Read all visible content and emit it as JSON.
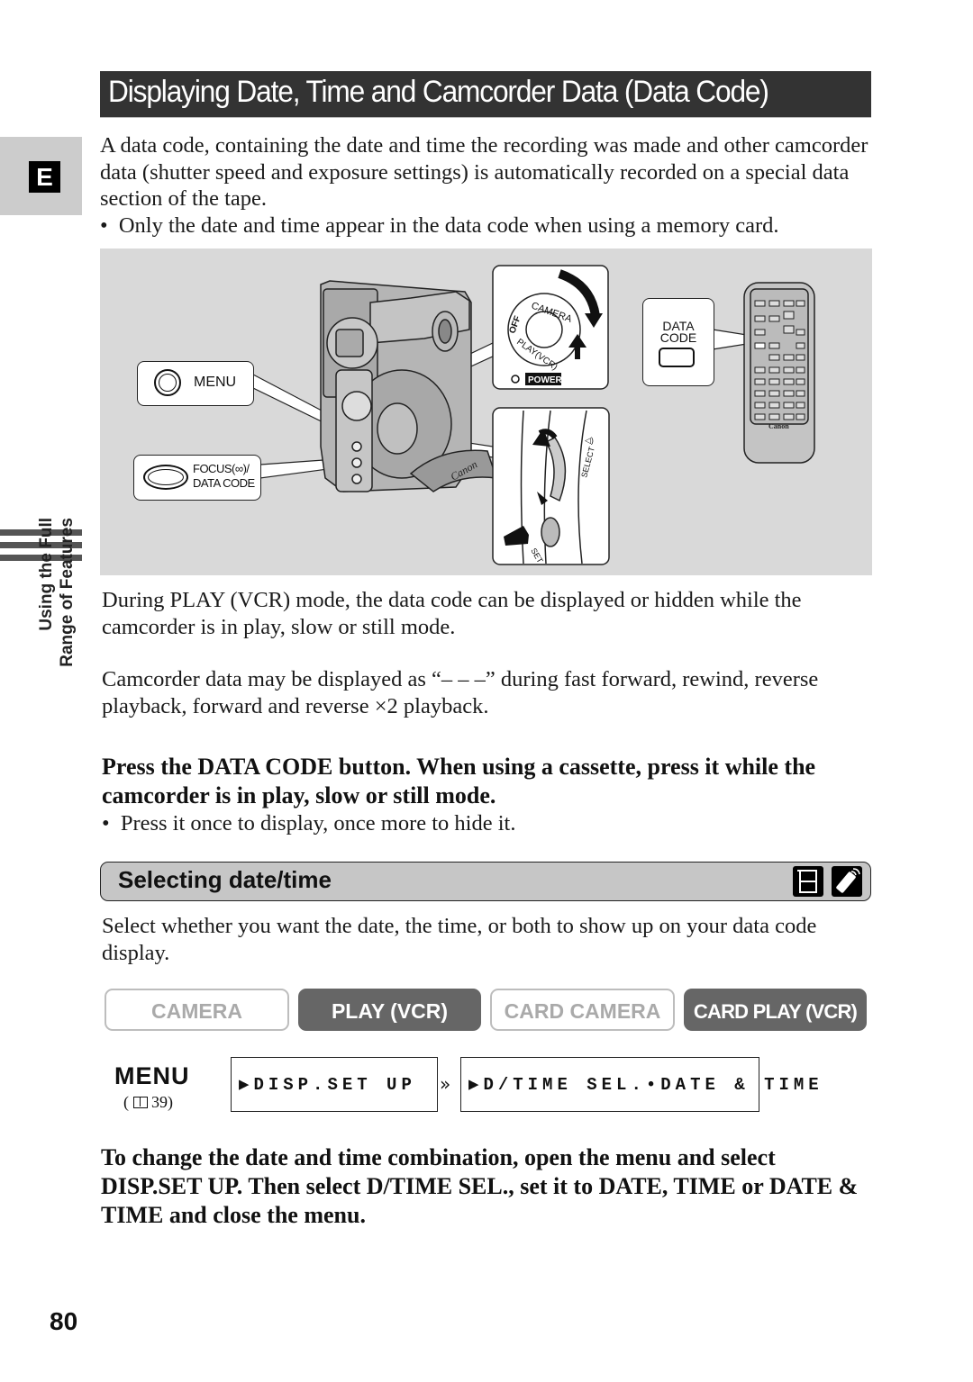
{
  "page": {
    "title": "Displaying Date, Time and Camcorder Data (Data Code)",
    "language_tab": "E",
    "side_label_line1": "Using the Full",
    "side_label_line2": "Range of Features",
    "page_number": "80"
  },
  "intro": {
    "paragraph": "A data code, containing the date and time the recording was made and other camcorder data (shutter speed and exposure settings) is automatically recorded on a special data section of the tape.",
    "bullet": "Only the date and time appear in the data code when using a memory card."
  },
  "figure": {
    "menu_callout": "MENU",
    "focus_callout_line1": "FOCUS(∞)/",
    "focus_callout_line2": "DATA CODE",
    "dial_labels": {
      "camera": "CAMERA",
      "off": "OFF",
      "play": "PLAY(VCR)",
      "power": "POWER"
    },
    "selector_labels": {
      "select": "SELECT",
      "set": "SET"
    },
    "remote_callout_line1": "DATA",
    "remote_callout_line2": "CODE",
    "remote_brand": "Canon",
    "camcorder_brand": "Canon"
  },
  "notes": {
    "play_mode": "During PLAY (VCR) mode, the data code can be displayed or hidden while the camcorder is in play, slow or still mode.",
    "dashes": "Camcorder data may be displayed as “– – –” during fast forward, rewind, reverse playback, forward and reverse ×2 playback."
  },
  "step": {
    "heading": "Press the DATA CODE button. When using a cassette, press it while the camcorder is in play, slow or still mode.",
    "bullet": "Press it once to display, once more to hide it."
  },
  "section": {
    "title": "Selecting date/time",
    "icons": [
      "camcorder-icon",
      "remote-control-icon"
    ],
    "description": "Select whether you want the date, the time, or both to show up on your data code display."
  },
  "modes": [
    {
      "label": "CAMERA",
      "active": false
    },
    {
      "label": "PLAY (VCR)",
      "active": true
    },
    {
      "label": "CARD CAMERA",
      "active": false
    },
    {
      "label": "CARD PLAY (VCR)",
      "active": true
    }
  ],
  "menu_path": {
    "menu_label": "MENU",
    "reference": "( 🕮39)",
    "reference_page": "39",
    "step1": "▶DISP.SET UP",
    "step2": "▶D/TIME SEL.•DATE & TIME"
  },
  "instruction": {
    "text": "To change the date and time combination, open the menu and select DISP.SET UP. Then select D/TIME SEL., set it to DATE, TIME or DATE & TIME and close the menu."
  },
  "colors": {
    "title_bg": "#333333",
    "tab_bg": "#cccccc",
    "figure_bg": "#d9d9d9",
    "section_bg": "#c6c6c6",
    "mode_active": "#666666",
    "mode_inactive_text": "#aaaaaa"
  }
}
